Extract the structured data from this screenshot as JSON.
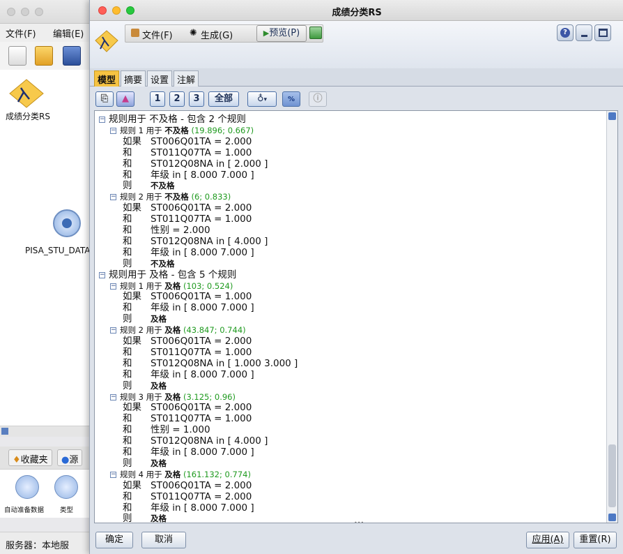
{
  "main_window": {
    "menus": [
      "文件(F)",
      "编辑(E)"
    ],
    "canvas_nodes": [
      {
        "label": "成绩分类RS",
        "icon": "model-nugget-icon"
      },
      {
        "label": "PISA_STU_DATA_",
        "icon": "data-source-icon"
      }
    ],
    "palette_tabs": [
      "收藏夹",
      "源"
    ],
    "palette_nodes": [
      "自动准备数据",
      "类型"
    ],
    "status": "服务器：本地服"
  },
  "dialog": {
    "title": "成绩分类RS",
    "menus": [
      "文件(F)",
      "生成(G)"
    ],
    "preview_button": "预览(P)",
    "tabs": [
      "模型",
      "摘要",
      "设置",
      "注解"
    ],
    "active_tab": "模型",
    "toolbar_buttons": [
      "1",
      "2",
      "3",
      "全部"
    ],
    "footer": {
      "ok": "确定",
      "cancel": "取消",
      "apply": "应用(A)",
      "reset": "重置(R)"
    }
  },
  "tree_rows": [
    {
      "level": 0,
      "type": "group",
      "text": "规则用于 不及格 - 包含 2 个规则"
    },
    {
      "level": 1,
      "type": "rule",
      "text": "规则 1 用于 ",
      "target": "不及格",
      "stats": " (19.896; 0.667)"
    },
    {
      "level": 2,
      "type": "cond",
      "kw": "如果",
      "text": "ST006Q01TA = 2.000"
    },
    {
      "level": 2,
      "type": "cond",
      "kw": "和",
      "text": "ST011Q07TA = 1.000"
    },
    {
      "level": 2,
      "type": "cond",
      "kw": "和",
      "text": "ST012Q08NA in [ 2.000 ]"
    },
    {
      "level": 2,
      "type": "cond",
      "kw": "和",
      "text": "年级 in [ 8.000 7.000 ]"
    },
    {
      "level": 2,
      "type": "then",
      "kw": "则",
      "text": "不及格"
    },
    {
      "level": 1,
      "type": "rule",
      "text": "规则 2 用于 ",
      "target": "不及格",
      "stats": " (6; 0.833)"
    },
    {
      "level": 2,
      "type": "cond",
      "kw": "如果",
      "text": "ST006Q01TA = 2.000"
    },
    {
      "level": 2,
      "type": "cond",
      "kw": "和",
      "text": "ST011Q07TA = 1.000"
    },
    {
      "level": 2,
      "type": "cond",
      "kw": "和",
      "text": "性别 = 2.000"
    },
    {
      "level": 2,
      "type": "cond",
      "kw": "和",
      "text": "ST012Q08NA in [ 4.000 ]"
    },
    {
      "level": 2,
      "type": "cond",
      "kw": "和",
      "text": "年级 in [ 8.000 7.000 ]"
    },
    {
      "level": 2,
      "type": "then",
      "kw": "则",
      "text": "不及格"
    },
    {
      "level": 0,
      "type": "group",
      "text": "规则用于 及格 - 包含 5 个规则"
    },
    {
      "level": 1,
      "type": "rule",
      "text": "规则 1 用于 ",
      "target": "及格",
      "stats": " (103; 0.524)"
    },
    {
      "level": 2,
      "type": "cond",
      "kw": "如果",
      "text": "ST006Q01TA = 1.000"
    },
    {
      "level": 2,
      "type": "cond",
      "kw": "和",
      "text": "年级 in [ 8.000 7.000 ]"
    },
    {
      "level": 2,
      "type": "then",
      "kw": "则",
      "text": "及格"
    },
    {
      "level": 1,
      "type": "rule",
      "text": "规则 2 用于 ",
      "target": "及格",
      "stats": " (43.847; 0.744)"
    },
    {
      "level": 2,
      "type": "cond",
      "kw": "如果",
      "text": "ST006Q01TA = 2.000"
    },
    {
      "level": 2,
      "type": "cond",
      "kw": "和",
      "text": "ST011Q07TA = 1.000"
    },
    {
      "level": 2,
      "type": "cond",
      "kw": "和",
      "text": "ST012Q08NA in [ 1.000 3.000 ]"
    },
    {
      "level": 2,
      "type": "cond",
      "kw": "和",
      "text": "年级 in [ 8.000 7.000 ]"
    },
    {
      "level": 2,
      "type": "then",
      "kw": "则",
      "text": "及格"
    },
    {
      "level": 1,
      "type": "rule",
      "text": "规则 3 用于 ",
      "target": "及格",
      "stats": " (3.125; 0.96)"
    },
    {
      "level": 2,
      "type": "cond",
      "kw": "如果",
      "text": "ST006Q01TA = 2.000"
    },
    {
      "level": 2,
      "type": "cond",
      "kw": "和",
      "text": "ST011Q07TA = 1.000"
    },
    {
      "level": 2,
      "type": "cond",
      "kw": "和",
      "text": "性别 = 1.000"
    },
    {
      "level": 2,
      "type": "cond",
      "kw": "和",
      "text": "ST012Q08NA in [ 4.000 ]"
    },
    {
      "level": 2,
      "type": "cond",
      "kw": "和",
      "text": "年级 in [ 8.000 7.000 ]"
    },
    {
      "level": 2,
      "type": "then",
      "kw": "则",
      "text": "及格"
    },
    {
      "level": 1,
      "type": "rule",
      "text": "规则 4 用于 ",
      "target": "及格",
      "stats": " (161.132; 0.774)"
    },
    {
      "level": 2,
      "type": "cond",
      "kw": "如果",
      "text": "ST006Q01TA = 2.000"
    },
    {
      "level": 2,
      "type": "cond",
      "kw": "和",
      "text": "ST011Q07TA = 2.000"
    },
    {
      "level": 2,
      "type": "cond",
      "kw": "和",
      "text": "年级 in [ 8.000 7.000 ]"
    },
    {
      "level": 2,
      "type": "then",
      "kw": "则",
      "text": "及格"
    }
  ]
}
